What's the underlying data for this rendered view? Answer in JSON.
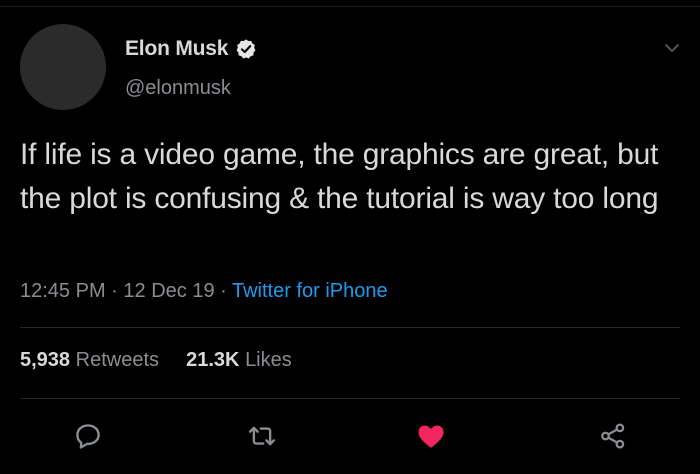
{
  "tweet": {
    "author": {
      "name": "Elon Musk",
      "handle": "@elonmusk",
      "verified": true
    },
    "text": "If life is a video game, the graphics are great, but the plot is confusing & the tutorial is way too long",
    "time": "12:45 PM",
    "date": "12 Dec 19",
    "separator": "·",
    "source": "Twitter for iPhone",
    "stats": {
      "retweets_count": "5,938",
      "retweets_label": "Retweets",
      "likes_count": "21.3K",
      "likes_label": "Likes"
    },
    "actions": [
      {
        "name": "reply",
        "icon": "reply-icon"
      },
      {
        "name": "retweet",
        "icon": "retweet-icon"
      },
      {
        "name": "like",
        "icon": "heart-icon",
        "active": true
      },
      {
        "name": "share",
        "icon": "share-icon"
      }
    ]
  },
  "colors": {
    "background": "#000000",
    "text": "#d9d9d9",
    "muted": "#8a8d91",
    "link": "#1d9bf0",
    "like_active": "#f4245e",
    "avatar_placeholder": "#2b2b2b"
  }
}
